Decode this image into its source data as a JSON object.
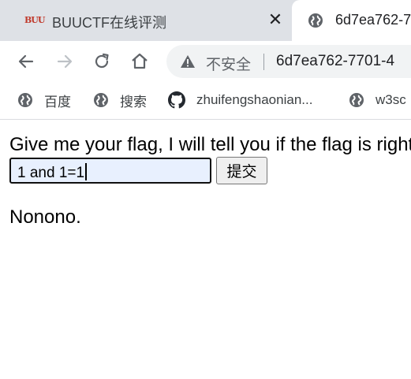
{
  "tabs": [
    {
      "title": "BUUCTF在线评测",
      "favicon": "buuctf-logo",
      "active": false
    },
    {
      "title": "6d7ea762-7",
      "favicon": "globe-icon",
      "active": true
    }
  ],
  "tab_favicon_text": "BUU",
  "tab_close_symbol": "✕",
  "toolbar": {
    "back_icon": "arrow-left-icon",
    "forward_icon": "arrow-right-icon",
    "reload_icon": "reload-icon",
    "home_icon": "home-icon"
  },
  "omnibox": {
    "security_icon": "warning-triangle-icon",
    "security_label": "不安全",
    "url": "6d7ea762-7701-4"
  },
  "bookmarks": [
    {
      "label": "百度",
      "icon": "globe-icon"
    },
    {
      "label": "搜索",
      "icon": "globe-icon"
    },
    {
      "label": "zhuifengshaonian...",
      "icon": "github-icon"
    },
    {
      "label": "w3sc",
      "icon": "globe-icon"
    }
  ],
  "page": {
    "prompt": "Give me your flag, I will tell you if the flag is right.",
    "input_value": "1 and 1=1",
    "submit_label": "提交",
    "result": "Nonono."
  },
  "colors": {
    "tabstrip_bg": "#dee1e6",
    "omnibox_bg": "#f1f3f4",
    "input_bg": "#e8f0fe"
  }
}
